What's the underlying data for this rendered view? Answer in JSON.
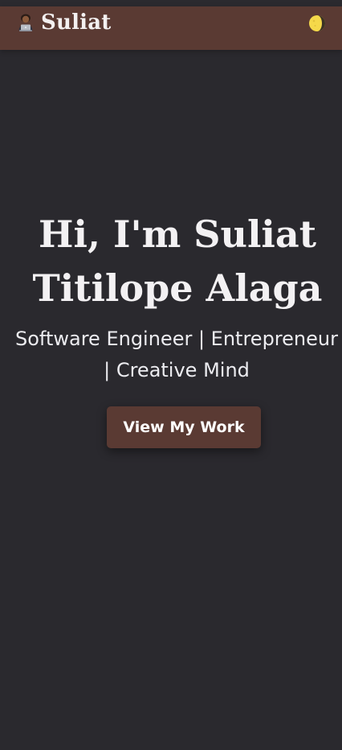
{
  "header": {
    "brand_name": "Suliat",
    "brand_icon": "technologist-laptop-icon",
    "theme_toggle_icon": "moon-icon"
  },
  "hero": {
    "title": "Hi, I'm Suliat Titilope Alaga",
    "subtitle": "Software Engineer | Entrepreneur | Creative Mind",
    "cta_label": "View My Work"
  },
  "colors": {
    "page_background": "#2a292e",
    "navbar_background": "#5a3a33",
    "button_background": "#5a3a33",
    "text_primary": "#f3f1f3"
  }
}
